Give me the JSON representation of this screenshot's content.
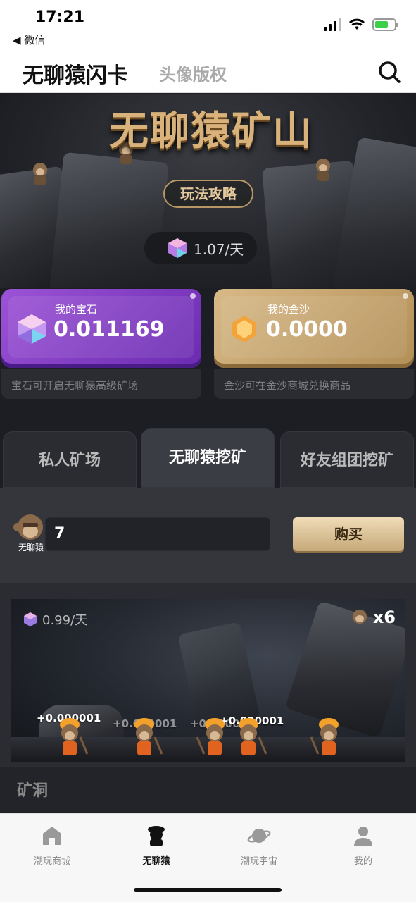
{
  "status_bar": {
    "time": "17:21",
    "back_label": "◀ 微信"
  },
  "header": {
    "title": "无聊猿闪卡",
    "secondary_tab": "头像版权"
  },
  "hero": {
    "title": "无聊猿矿山",
    "guide_button": "玩法攻略",
    "rate": "1.07/天"
  },
  "cards": {
    "gem": {
      "label": "我的宝石",
      "value": "0.011169",
      "note": "宝石可开启无聊猿高级矿场"
    },
    "gold": {
      "label": "我的金沙",
      "value": "0.0000",
      "note": "金沙可在金沙商城兑换商品"
    }
  },
  "tabs": [
    {
      "label": "私人矿场",
      "active": false
    },
    {
      "label": "无聊猿挖矿",
      "active": true
    },
    {
      "label": "好友组团挖矿",
      "active": false
    }
  ],
  "purchase": {
    "avatar_caption": "无聊猿",
    "quantity": "7",
    "buy_label": "购买"
  },
  "mine": {
    "rate": "0.99/天",
    "count": "x6",
    "labels": [
      "+0.000001",
      "+0.000001",
      "+0.000001",
      "+0.000001"
    ]
  },
  "cave": {
    "label": "矿洞"
  },
  "bottom_nav": [
    {
      "label": "潮玩商城",
      "icon": "store-icon",
      "active": false
    },
    {
      "label": "无聊猿",
      "icon": "ape-icon",
      "active": true
    },
    {
      "label": "潮玩宇宙",
      "icon": "planet-icon",
      "active": false
    },
    {
      "label": "我的",
      "icon": "profile-icon",
      "active": false
    }
  ],
  "colors": {
    "gem_card": "#9c53d6",
    "gold_card": "#d8b987",
    "buy_button": "#e7cfa5"
  }
}
